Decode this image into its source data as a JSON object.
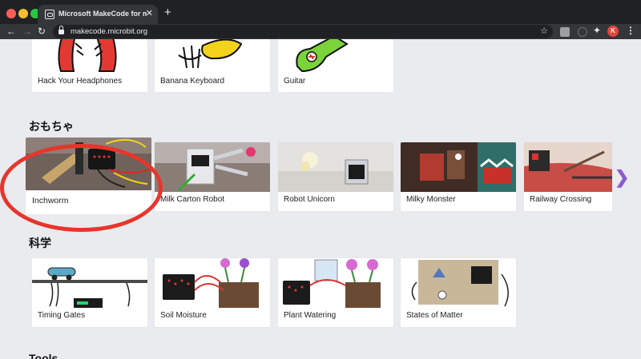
{
  "browser": {
    "tab_title": "Microsoft MakeCode for micro:bit",
    "tab_close": "✕",
    "new_tab": "+",
    "back": "←",
    "forward": "→",
    "reload": "↻",
    "url": "makecode.microbit.org",
    "star": "☆",
    "puzzle": "✦",
    "avatar": "K",
    "menu": "⋮"
  },
  "sections": {
    "music": {
      "cards": [
        {
          "label": "Hack Your Headphones"
        },
        {
          "label": "Banana Keyboard"
        },
        {
          "label": "Guitar"
        }
      ]
    },
    "toys": {
      "title": "おもちゃ",
      "cards": [
        {
          "label": "Inchworm"
        },
        {
          "label": "Milk Carton Robot"
        },
        {
          "label": "Robot Unicorn"
        },
        {
          "label": "Milky Monster"
        },
        {
          "label": "Railway Crossing"
        }
      ],
      "next_arrow": "❯"
    },
    "science": {
      "title": "科学",
      "cards": [
        {
          "label": "Timing Gates"
        },
        {
          "label": "Soil Moisture"
        },
        {
          "label": "Plant Watering"
        },
        {
          "label": "States of Matter"
        }
      ]
    },
    "tools": {
      "title": "Tools"
    }
  },
  "colors": {
    "highlight": "#e8352b",
    "carousel_arrow": "#8e5cd2",
    "page_bg": "#e9ebee"
  }
}
